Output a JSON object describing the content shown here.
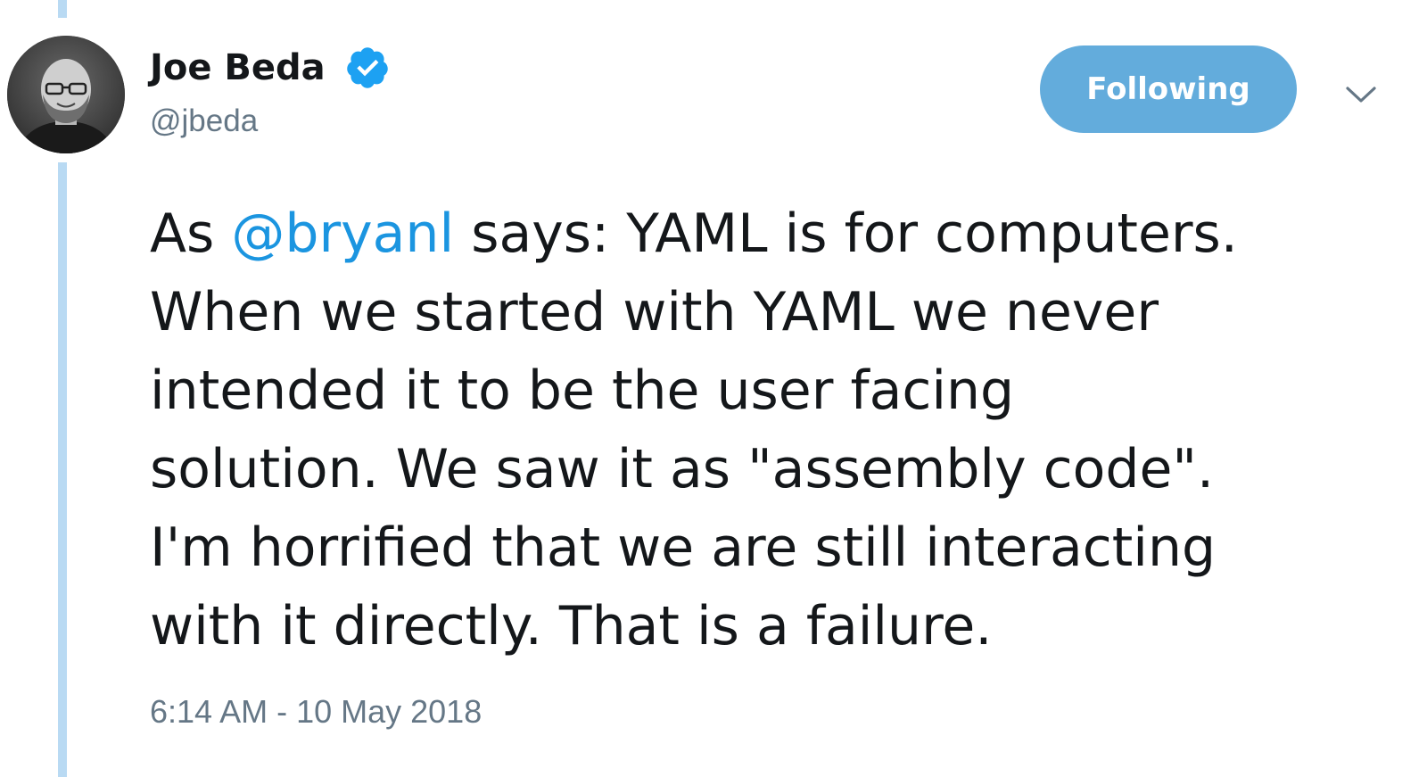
{
  "author": {
    "name": "Joe Beda",
    "handle": "@jbeda",
    "verified": true,
    "avatar_icon": "profile-photo"
  },
  "follow_button": {
    "label": "Following"
  },
  "menu_icon": "chevron-down-icon",
  "tweet": {
    "segments": {
      "prefix": "As ",
      "mention": "@bryanl",
      "line1_rest": " says: YAML is for computers.",
      "line2": "When we started with YAML we never",
      "line3": "intended it to be the user facing",
      "line4": "solution. We saw it as \"assembly code\".",
      "line5": "I'm horrified that we are still interacting",
      "line6": "with it directly. That is a failure."
    }
  },
  "timestamp": "6:14 AM - 10 May 2018",
  "colors": {
    "link": "#1b95e0",
    "button_bg": "#63acdc",
    "thread_line": "#b9daf3",
    "muted_text": "#657786",
    "verified": "#1da1f2"
  }
}
